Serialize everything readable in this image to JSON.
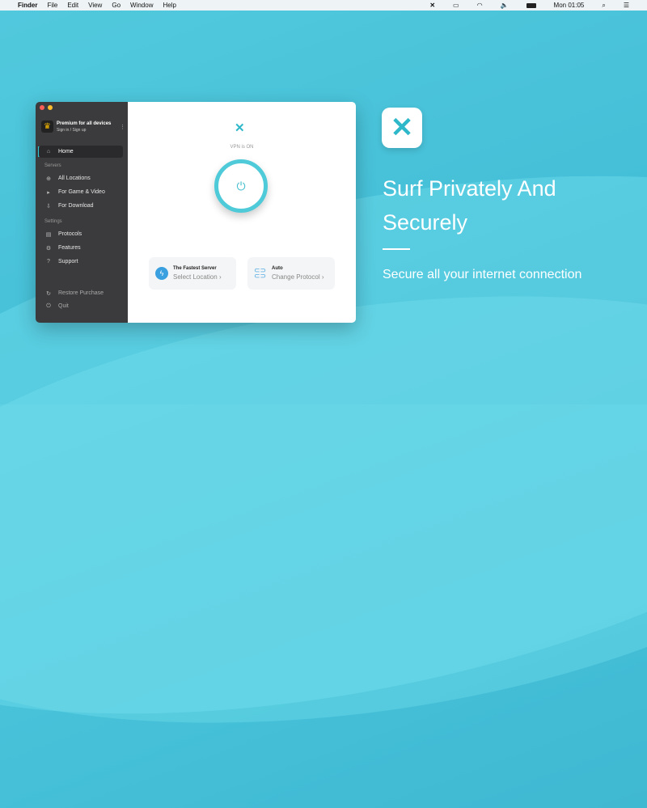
{
  "menubar": {
    "items": [
      "Finder",
      "File",
      "Edit",
      "View",
      "Go",
      "Window",
      "Help"
    ],
    "clock": "Mon 01:05"
  },
  "sidebar": {
    "account_title": "Premium for all devices",
    "account_sub": "Sign in / Sign up",
    "home": "Home",
    "servers_header": "Servers",
    "servers": [
      "All Locations",
      "For Game & Video",
      "For Download"
    ],
    "settings_header": "Settings",
    "settings": [
      "Protocols",
      "Features",
      "Support"
    ],
    "restore": "Restore Purchase",
    "quit": "Quit"
  },
  "main": {
    "status": "VPN is ON",
    "server_card": {
      "title": "The Fastest Server",
      "action": "Select Location"
    },
    "protocol_card": {
      "title": "Auto",
      "action": "Change Protocol"
    }
  },
  "promo": {
    "title_line1": "Surf Privately And",
    "title_line2": "Securely",
    "subtitle": "Secure all your internet connection"
  },
  "colors": {
    "accent": "#2fb8c9",
    "sidebar": "#3b3b3d"
  }
}
